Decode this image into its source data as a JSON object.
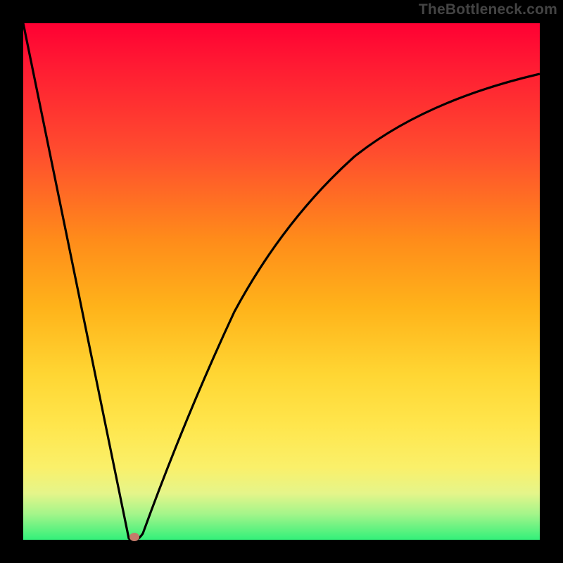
{
  "attribution": "TheBottleneck.com",
  "colors": {
    "plot_border": "#000000",
    "curve_stroke": "#000000",
    "marker_fill": "#c47a6a",
    "gradient_top": "#ff0033",
    "gradient_bottom": "#33f07a"
  },
  "chart_data": {
    "type": "line",
    "title": "",
    "xlabel": "",
    "ylabel": "",
    "xlim": [
      0,
      100
    ],
    "ylim": [
      0,
      100
    ],
    "grid": false,
    "series": [
      {
        "name": "curve",
        "x": [
          0,
          5,
          10,
          15,
          18.5,
          20.5,
          22,
          25,
          28,
          32,
          36,
          40,
          45,
          50,
          55,
          60,
          65,
          70,
          75,
          80,
          85,
          90,
          95,
          100
        ],
        "y": [
          100,
          73,
          46,
          19,
          1,
          0,
          1.5,
          12,
          28,
          44,
          54,
          61,
          68,
          73,
          77,
          80,
          82.5,
          84.5,
          86,
          87.3,
          88.3,
          89.1,
          89.7,
          90.2
        ]
      }
    ],
    "marker": {
      "x": 20.5,
      "y": 0
    }
  }
}
